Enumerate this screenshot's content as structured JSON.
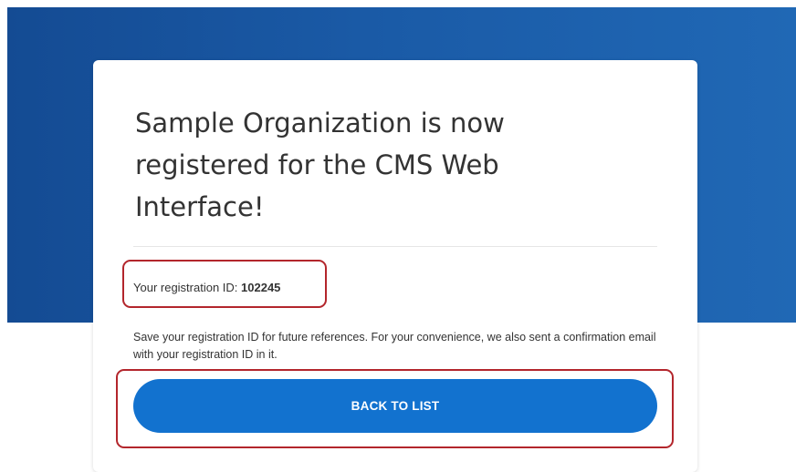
{
  "card": {
    "title": "Sample Organization is now registered for the CMS Web Interface!",
    "registration_label": "Your registration ID: ",
    "registration_id": "102245",
    "save_note": "Save your registration ID for future references. For your convenience, we also sent a confirmation email with your registration ID in it.",
    "back_button_label": "BACK TO LIST"
  },
  "colors": {
    "header_band": "#1a5aa6",
    "button": "#1272cf",
    "highlight": "#b3262c"
  }
}
